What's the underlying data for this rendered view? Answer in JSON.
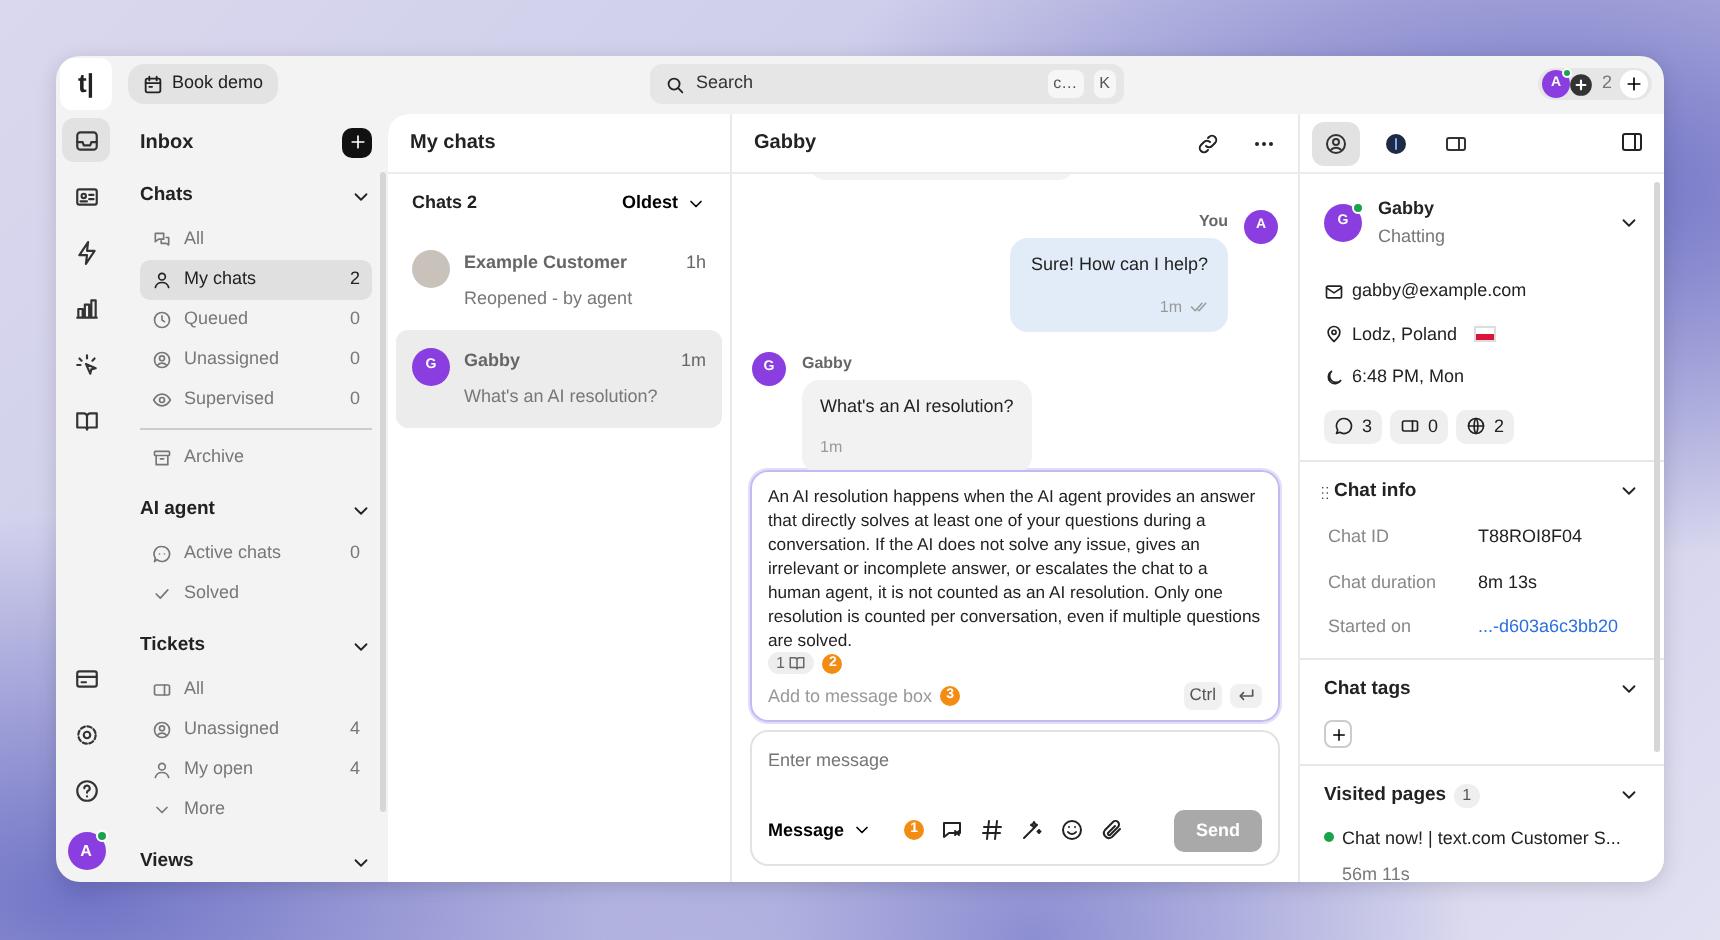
{
  "top_bar": {
    "logo": "t|",
    "book_demo": "Book demo",
    "search": {
      "placeholder": "Search",
      "keys": [
        "c…",
        "K"
      ]
    },
    "agents": {
      "initial": "A",
      "online": true,
      "count": "2"
    }
  },
  "rail": {
    "items": [
      {
        "selected": true
      },
      {
        "selected": false
      },
      {
        "selected": false
      },
      {
        "selected": false
      },
      {
        "selected": false
      },
      {
        "selected": false
      }
    ],
    "bottom_items": [
      {
        "selected": false
      },
      {
        "selected": false
      },
      {
        "selected": false
      }
    ],
    "user": {
      "initial": "A",
      "online": true
    }
  },
  "sidebar": {
    "title": "Inbox",
    "sections": [
      {
        "title": "Chats",
        "items": [
          {
            "label": "All",
            "selected": false
          },
          {
            "label": "My chats",
            "count": "2",
            "selected": true
          },
          {
            "label": "Queued",
            "count": "0",
            "selected": false
          },
          {
            "label": "Unassigned",
            "count": "0",
            "selected": false
          },
          {
            "label": "Supervised",
            "count": "0",
            "selected": false
          }
        ],
        "extra_items": [
          {
            "label": "Archive",
            "selected": false
          }
        ]
      },
      {
        "title": "AI agent",
        "items": [
          {
            "label": "Active chats",
            "count": "0",
            "selected": false
          },
          {
            "label": "Solved",
            "selected": false
          }
        ]
      },
      {
        "title": "Tickets",
        "items": [
          {
            "label": "All",
            "selected": false
          },
          {
            "label": "Unassigned",
            "count": "4",
            "selected": false
          },
          {
            "label": "My open",
            "count": "4",
            "selected": false
          },
          {
            "label": "More",
            "selected": false
          }
        ]
      },
      {
        "title": "Views"
      }
    ]
  },
  "chat_list": {
    "title": "My chats",
    "count_label": "Chats 2",
    "sort": "Oldest",
    "chats": [
      {
        "kind": "photo",
        "name": "Example Customer",
        "preview": "Reopened - by agent",
        "time": "1h",
        "selected": false
      },
      {
        "kind": "initial",
        "initial": "G",
        "name": "Gabby",
        "preview": "What's an AI resolution?",
        "time": "1m",
        "selected": true
      }
    ]
  },
  "chat": {
    "title": "Gabby",
    "messages": [
      {
        "kind": "agent",
        "author": "You",
        "initial": "A",
        "text": "Sure! How can I help?",
        "time": "1m",
        "read": true
      },
      {
        "kind": "customer",
        "author": "Gabby",
        "initial": "G",
        "text": "What's an AI resolution?",
        "time": "1m"
      }
    ],
    "suggestion": {
      "text": "An AI resolution happens when the AI agent provides an answer that directly solves at least one of your questions during a conversation. If the AI does not solve any issue, gives an irrelevant or incomplete answer, or escalates the chat to a human agent, it is not counted as an AI resolution. Only one resolution is counted per conversation, even if multiple questions are solved.",
      "sources": "1",
      "step": "2",
      "action": "Add to message box",
      "action_step": "3",
      "key": "Ctrl"
    },
    "composer": {
      "placeholder": "Enter message",
      "mode": "Message",
      "step": "1",
      "send": "Send",
      "send_disabled": true
    }
  },
  "details": {
    "tabs": [
      {
        "selected": true
      },
      {
        "selected": false
      },
      {
        "selected": false
      }
    ],
    "customer": {
      "initial": "G",
      "online": true,
      "name": "Gabby",
      "status": "Chatting",
      "email": "gabby@example.com",
      "location": "Lodz, Poland",
      "local_time": "6:48 PM, Mon",
      "stats": [
        "3",
        "0",
        "2"
      ]
    },
    "chat_info": {
      "title": "Chat info",
      "rows": [
        {
          "label": "Chat ID",
          "value": "T88ROI8F04",
          "kind": "text"
        },
        {
          "label": "Chat duration",
          "value": "8m 13s",
          "kind": "text"
        },
        {
          "label": "Started on",
          "value": "...-d603a6c3bb20",
          "kind": "link"
        }
      ]
    },
    "chat_tags": {
      "title": "Chat tags"
    },
    "visited_pages": {
      "title": "Visited pages",
      "count": "1",
      "pages": [
        {
          "title": "Chat now! | text.com Customer S...",
          "duration": "56m 11s"
        }
      ]
    }
  }
}
